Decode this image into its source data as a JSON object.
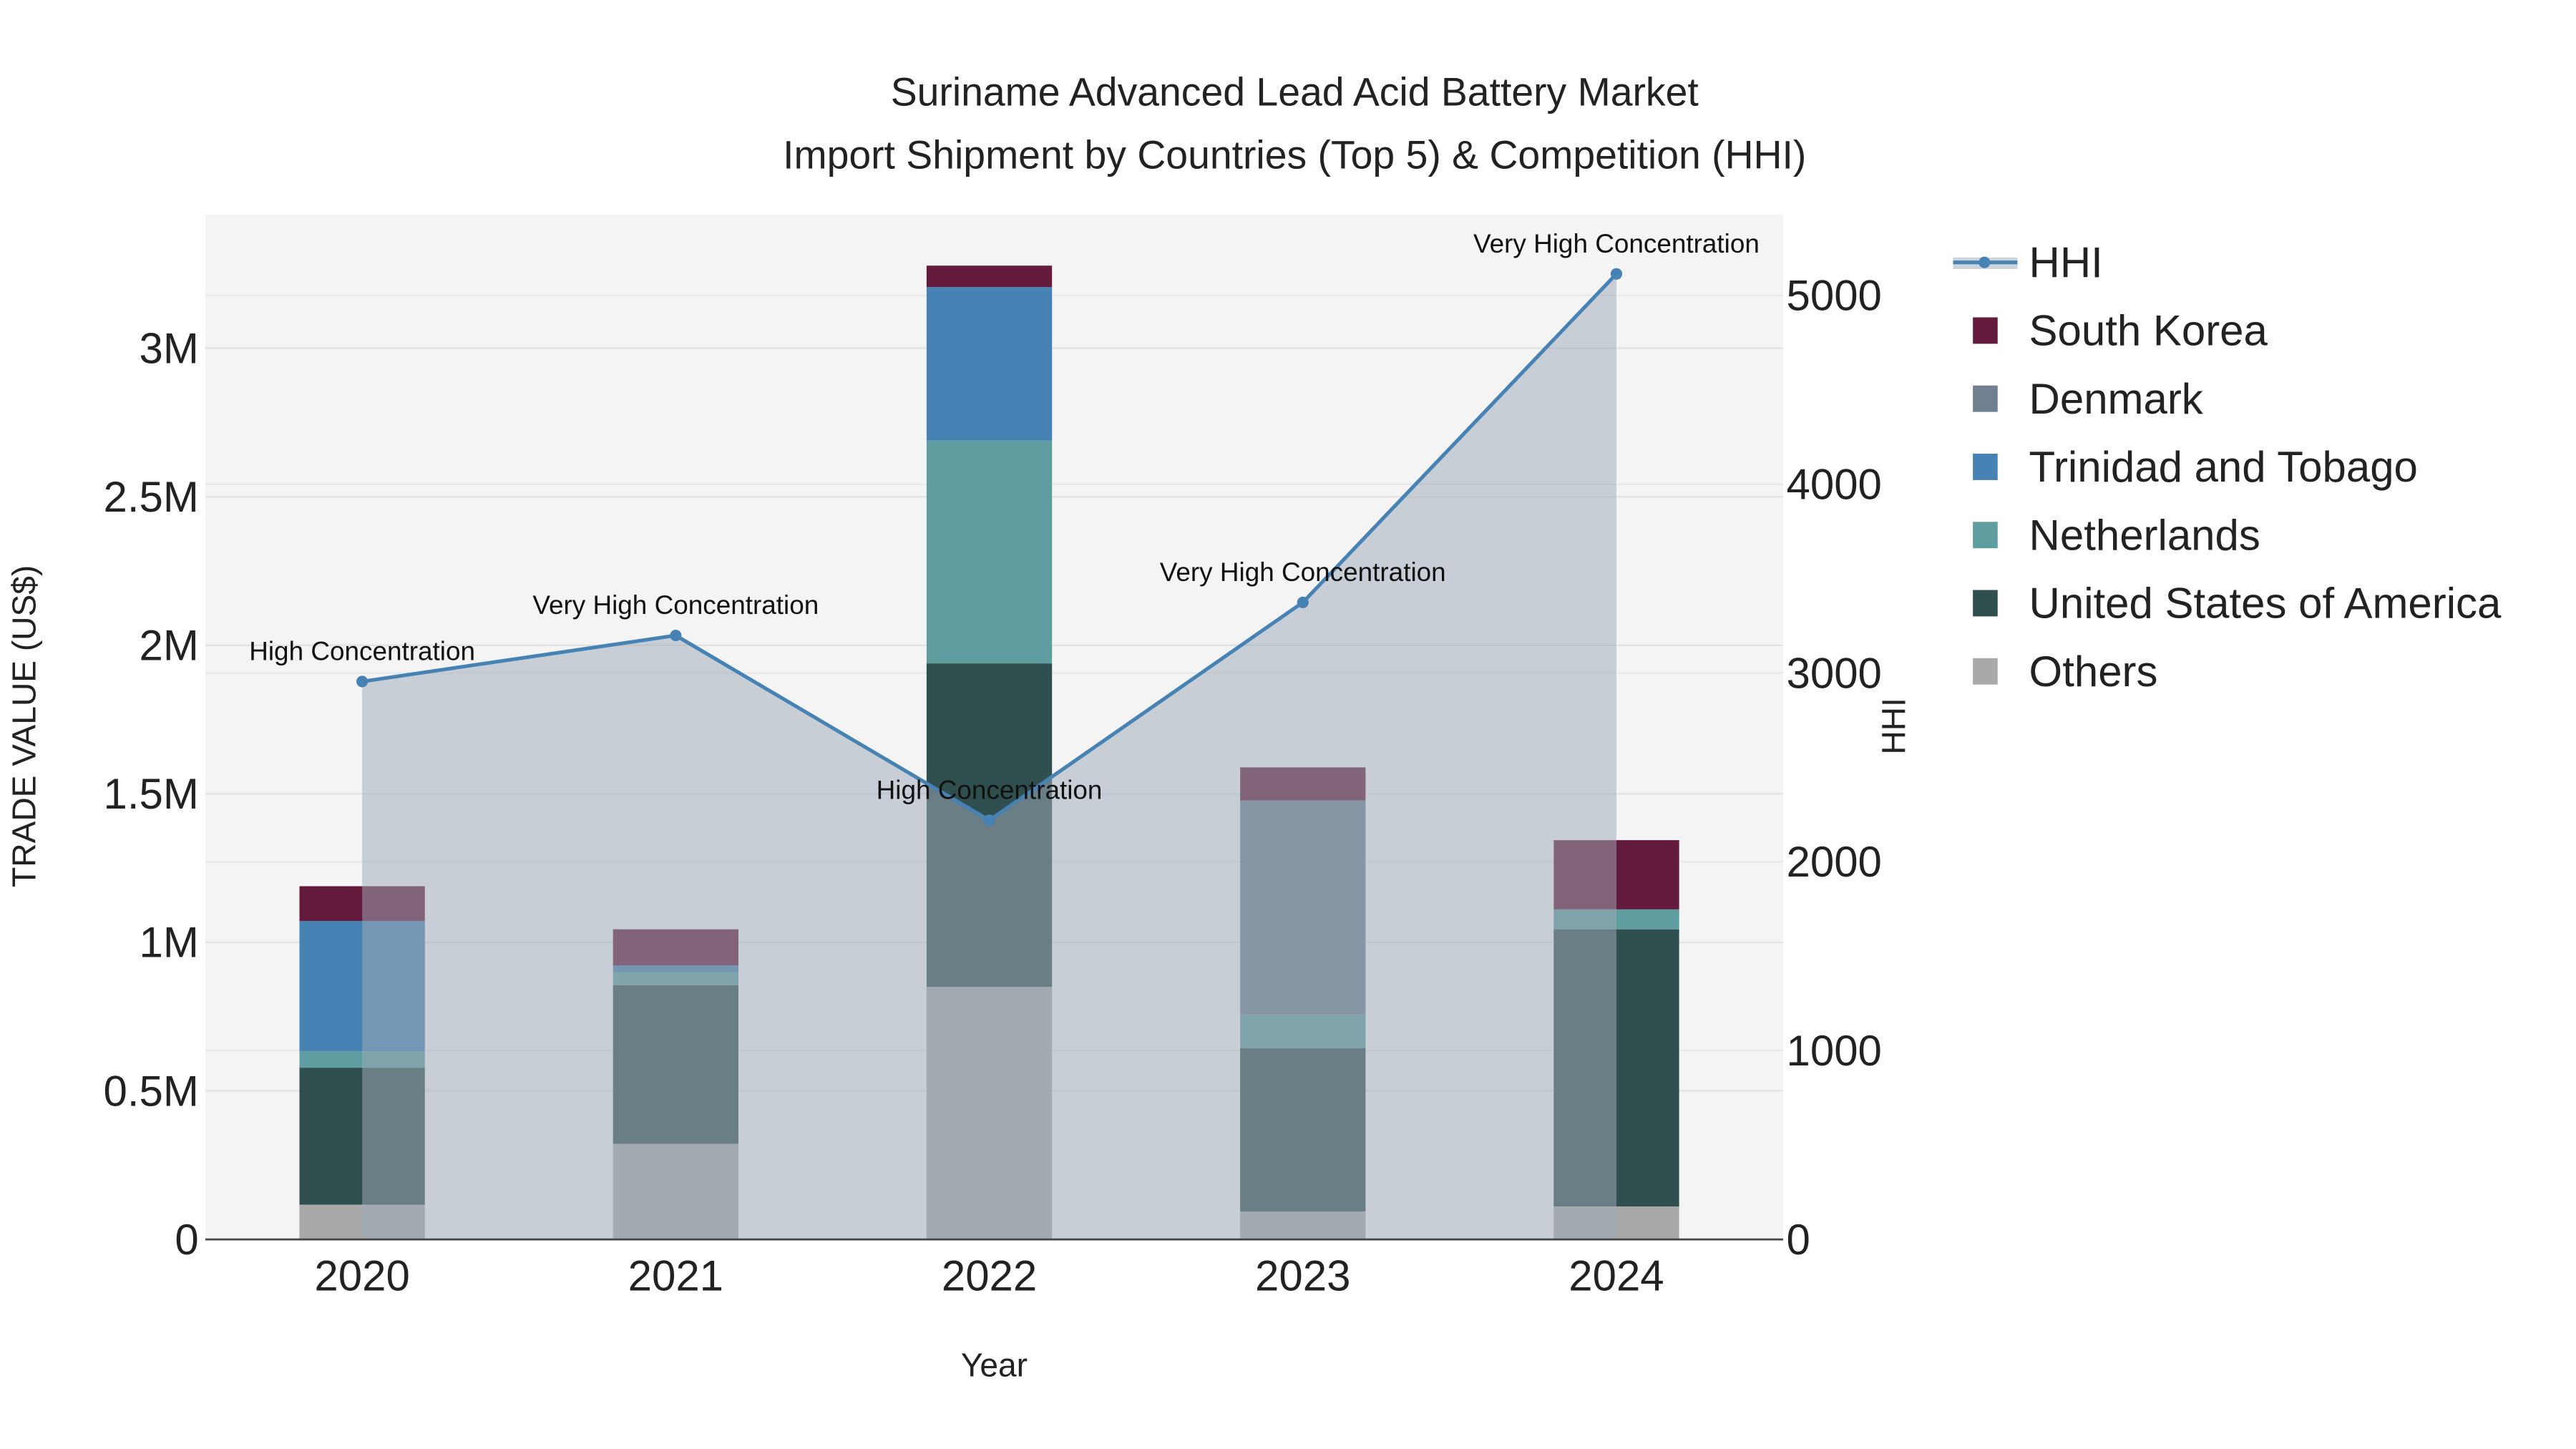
{
  "chart_data": {
    "type": "bar",
    "title": "Suriname Advanced Lead Acid Battery Market",
    "subtitle": "Import Shipment by Countries (Top 5) & Competition (HHI)",
    "xlabel": "Year",
    "ylabel": "TRADE VALUE (US$)",
    "y2label": "HHI",
    "categories": [
      "2020",
      "2021",
      "2022",
      "2023",
      "2024"
    ],
    "ylim": [
      0,
      3450000
    ],
    "y2lim": [
      0,
      5430
    ],
    "yticks": [
      {
        "v": 0,
        "label": "0"
      },
      {
        "v": 500000,
        "label": "0.5M"
      },
      {
        "v": 1000000,
        "label": "1M"
      },
      {
        "v": 1500000,
        "label": "1.5M"
      },
      {
        "v": 2000000,
        "label": "2M"
      },
      {
        "v": 2500000,
        "label": "2.5M"
      },
      {
        "v": 3000000,
        "label": "3M"
      }
    ],
    "y2ticks": [
      {
        "v": 0,
        "label": "0"
      },
      {
        "v": 1000,
        "label": "1000"
      },
      {
        "v": 2000,
        "label": "2000"
      },
      {
        "v": 3000,
        "label": "3000"
      },
      {
        "v": 4000,
        "label": "4000"
      },
      {
        "v": 5000,
        "label": "5000"
      }
    ],
    "series": [
      {
        "name": "Others",
        "color": "#a9a9a9",
        "values": [
          117000,
          322000,
          850000,
          94000,
          111000
        ]
      },
      {
        "name": "United States of America",
        "color": "#2f4f4f",
        "values": [
          461000,
          534000,
          1089000,
          550000,
          933000
        ]
      },
      {
        "name": "Netherlands",
        "color": "#5f9ea0",
        "values": [
          55000,
          44000,
          750000,
          112000,
          67000
        ]
      },
      {
        "name": "Trinidad and Tobago",
        "color": "#4682b4",
        "values": [
          439000,
          22000,
          517000,
          0,
          0
        ]
      },
      {
        "name": "Denmark",
        "color": "#708090",
        "values": [
          0,
          0,
          0,
          722000,
          0
        ]
      },
      {
        "name": "South Korea",
        "color": "#641a3a",
        "values": [
          117000,
          122000,
          72000,
          111000,
          233000
        ]
      }
    ],
    "hhi": {
      "name": "HHI",
      "color": "#4682b4",
      "values": [
        2955,
        3199,
        2220,
        3374,
        5114
      ],
      "annotations": [
        "High Concentration",
        "Very High Concentration",
        "High Concentration",
        "Very High Concentration",
        "Very High Concentration"
      ]
    },
    "legend_order": [
      "HHI",
      "South Korea",
      "Denmark",
      "Trinidad and Tobago",
      "Netherlands",
      "United States of America",
      "Others"
    ],
    "legend_position": "right",
    "grid": true
  }
}
